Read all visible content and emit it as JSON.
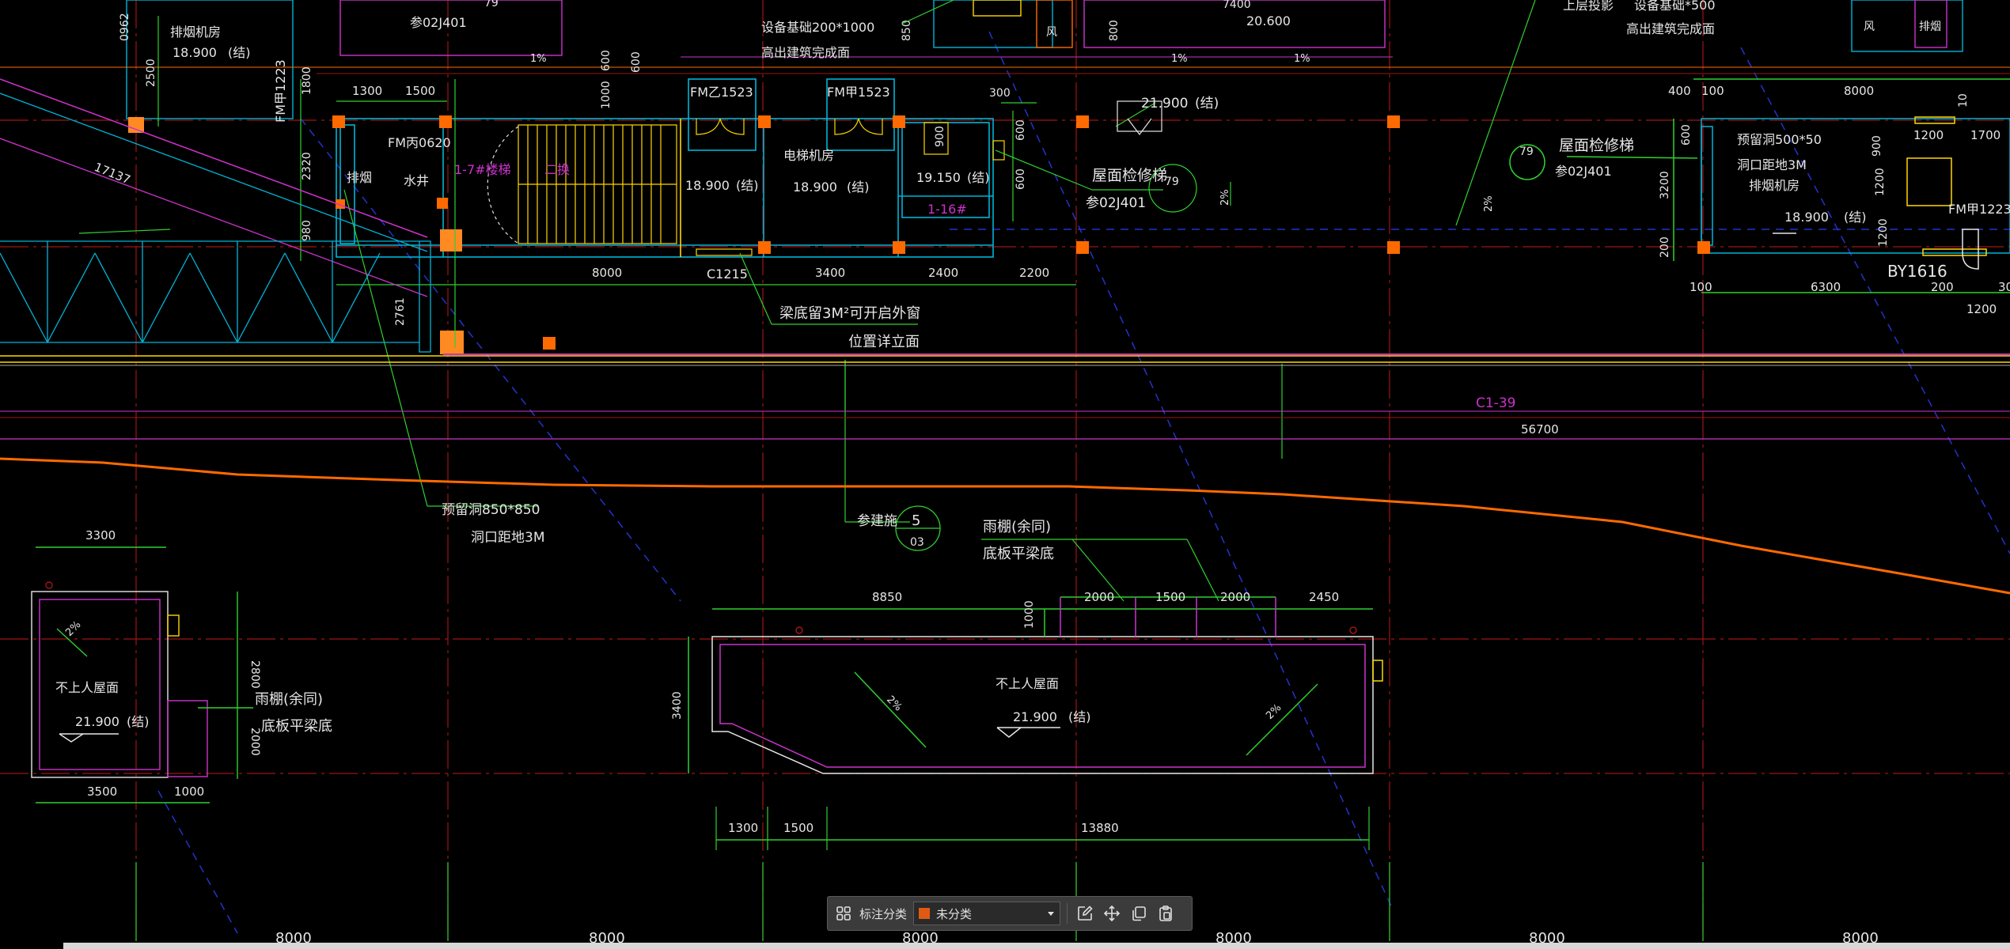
{
  "colors": {
    "background": "#000000",
    "wall": "#00b4d8",
    "dim": "#2fd12f",
    "text": "#e6e6e6",
    "tag": "#ffd700",
    "magenta": "#cc33cc",
    "orange": "#ff6a00",
    "axis": "#b01818",
    "column": "#ff6a00"
  },
  "drawing": {
    "top_left_texts": [
      "排烟机房",
      "18.900",
      "(结)",
      "FM甲1223",
      "2500",
      "1800",
      "2320",
      "980",
      "2761",
      "0962"
    ],
    "stair_block": {
      "dims_top": [
        "1300",
        "1500",
        "1000",
        "600"
      ],
      "fm_620": "FM丙0620",
      "smoke": "排烟",
      "water_well": "水井",
      "stair_label": "1-7#楼梯",
      "stair_tag": "二换",
      "el1": "18.900",
      "el1_tag": "(结)",
      "fm1": "FM乙1523",
      "fm2": "FM甲1523",
      "elevator_room": "电梯机房",
      "el2": "18.900",
      "el2_tag": "(结)",
      "dim_900": "900",
      "el3": "19.150",
      "el3_tag": "(结)",
      "elev_16": "1-16#",
      "dim_300": "300",
      "dim_600a": "600",
      "dim_600b": "600",
      "dims_bottom": [
        "8000",
        "3400",
        "2400",
        "2200"
      ],
      "window": "C1215",
      "note_line1": "梁底留3M²可开启外窗",
      "note_line2": "位置详立面"
    },
    "top_notes": {
      "equip1": "设备基础200*1000",
      "equip2": "高出建筑完成面",
      "upper_proj": "上层投影",
      "equip3": "设备基础*500",
      "equip4": "高出建筑完成面",
      "el_20600": "20.600",
      "d7400": "7400",
      "d850": "850",
      "d800": "800",
      "d600": "600",
      "ref_79": "79",
      "ref_02j401": "参02J401",
      "wind": "风",
      "smoke": "排烟",
      "pct": "1%"
    },
    "ladder": {
      "el": "21.900",
      "el_tag": "(结)",
      "label": "屋面检修梯",
      "ref_num": "79",
      "ref_code": "参02J401",
      "slope": "2%"
    },
    "right_room": {
      "dims_top": [
        "400",
        "100",
        "8000",
        "10"
      ],
      "ref_num": "79",
      "ladder_label": "屋面检修梯",
      "ref_code": "参02J401",
      "hole_1": "预留洞500*50",
      "hole_2": "洞口距地3M",
      "dims_side": [
        "1200",
        "1700",
        "900",
        "1200",
        "1200"
      ],
      "fm": "FM甲1223",
      "smoke_room": "排烟机房",
      "el": "18.900",
      "el_tag": "(结)",
      "dim_3200": "3200",
      "dim_600": "600",
      "dim_200": "200",
      "dims_bottom": [
        "100",
        "6300",
        "200",
        "30"
      ],
      "dim_1200": "1200",
      "by": "BY1616",
      "slope": "2%"
    },
    "line_labels": {
      "c1_39": "C1-39",
      "d56700": "56700",
      "d17137": "17137"
    },
    "hole_note": {
      "line1": "预留洞850*850",
      "line2": "洞口距地3M"
    },
    "ref_5": {
      "label": "参建施",
      "num": "5",
      "code": "03"
    },
    "canopy_note_top": {
      "line1": "雨棚(余同)",
      "line2": "底板平梁底"
    },
    "left_small_roof": {
      "d3300": "3300",
      "slope": "2%",
      "label": "不上人屋面",
      "el": "21.900",
      "el_tag": "(结)",
      "d2800": "2800",
      "d2000": "2000",
      "d3500": "3500",
      "d1000": "1000",
      "canopy_1": "雨棚(余同)",
      "canopy_2": "底板平梁底"
    },
    "big_roof": {
      "dims_top": [
        "8850",
        "2000",
        "1500",
        "2000",
        "2450"
      ],
      "d1000": "1000",
      "d3400": "3400",
      "label": "不上人屋面",
      "el": "21.900",
      "el_tag": "(结)",
      "slope_l": "2%",
      "slope_r": "2%",
      "dims_bottom": [
        "1300",
        "1500",
        "13880"
      ]
    },
    "axis_bottom": [
      "8000",
      "8000",
      "8000",
      "8000",
      "8000",
      "8000"
    ]
  },
  "toolbar": {
    "grid_icon": "grid-icon",
    "label": "标注分类",
    "swatch_color": "#e05a14",
    "selected": "未分类",
    "icons": [
      "edit-icon",
      "move-icon",
      "copy-icon",
      "paste-icon"
    ]
  }
}
